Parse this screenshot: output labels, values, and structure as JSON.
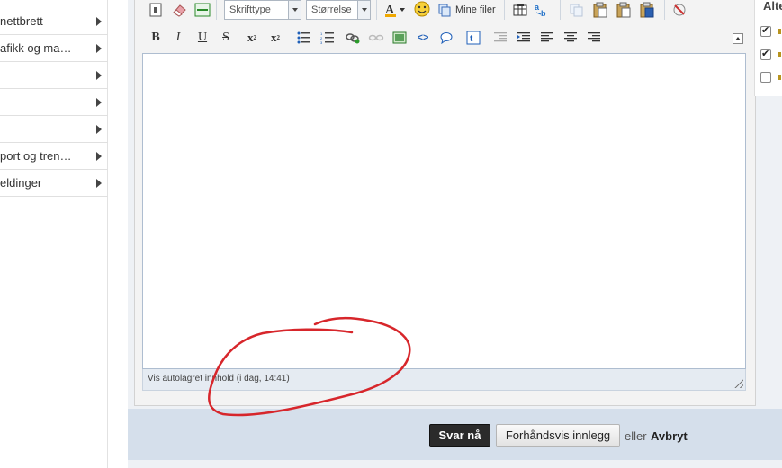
{
  "sidebar": {
    "items": [
      {
        "label": "nettbrett"
      },
      {
        "label": "afikk og ma…"
      },
      {
        "label": ""
      },
      {
        "label": ""
      },
      {
        "label": ""
      },
      {
        "label": "port og tren…"
      },
      {
        "label": "eldinger"
      }
    ]
  },
  "toolbar": {
    "font_placeholder": "Skrifttype",
    "size_placeholder": "Størrelse",
    "my_files_label": "Mine filer"
  },
  "status": {
    "autosave_text": "Vis autolagret innhold (i dag, 14:41)"
  },
  "footer": {
    "reply_label": "Svar nå",
    "preview_label": "Forhåndsvis innlegg",
    "or_text": "eller",
    "cancel_label": "Avbryt"
  },
  "right_panel": {
    "title": "Alte",
    "checkboxes": [
      {
        "checked": true
      },
      {
        "checked": true
      },
      {
        "checked": false
      }
    ]
  },
  "annotation": {
    "color": "#d7262b"
  }
}
